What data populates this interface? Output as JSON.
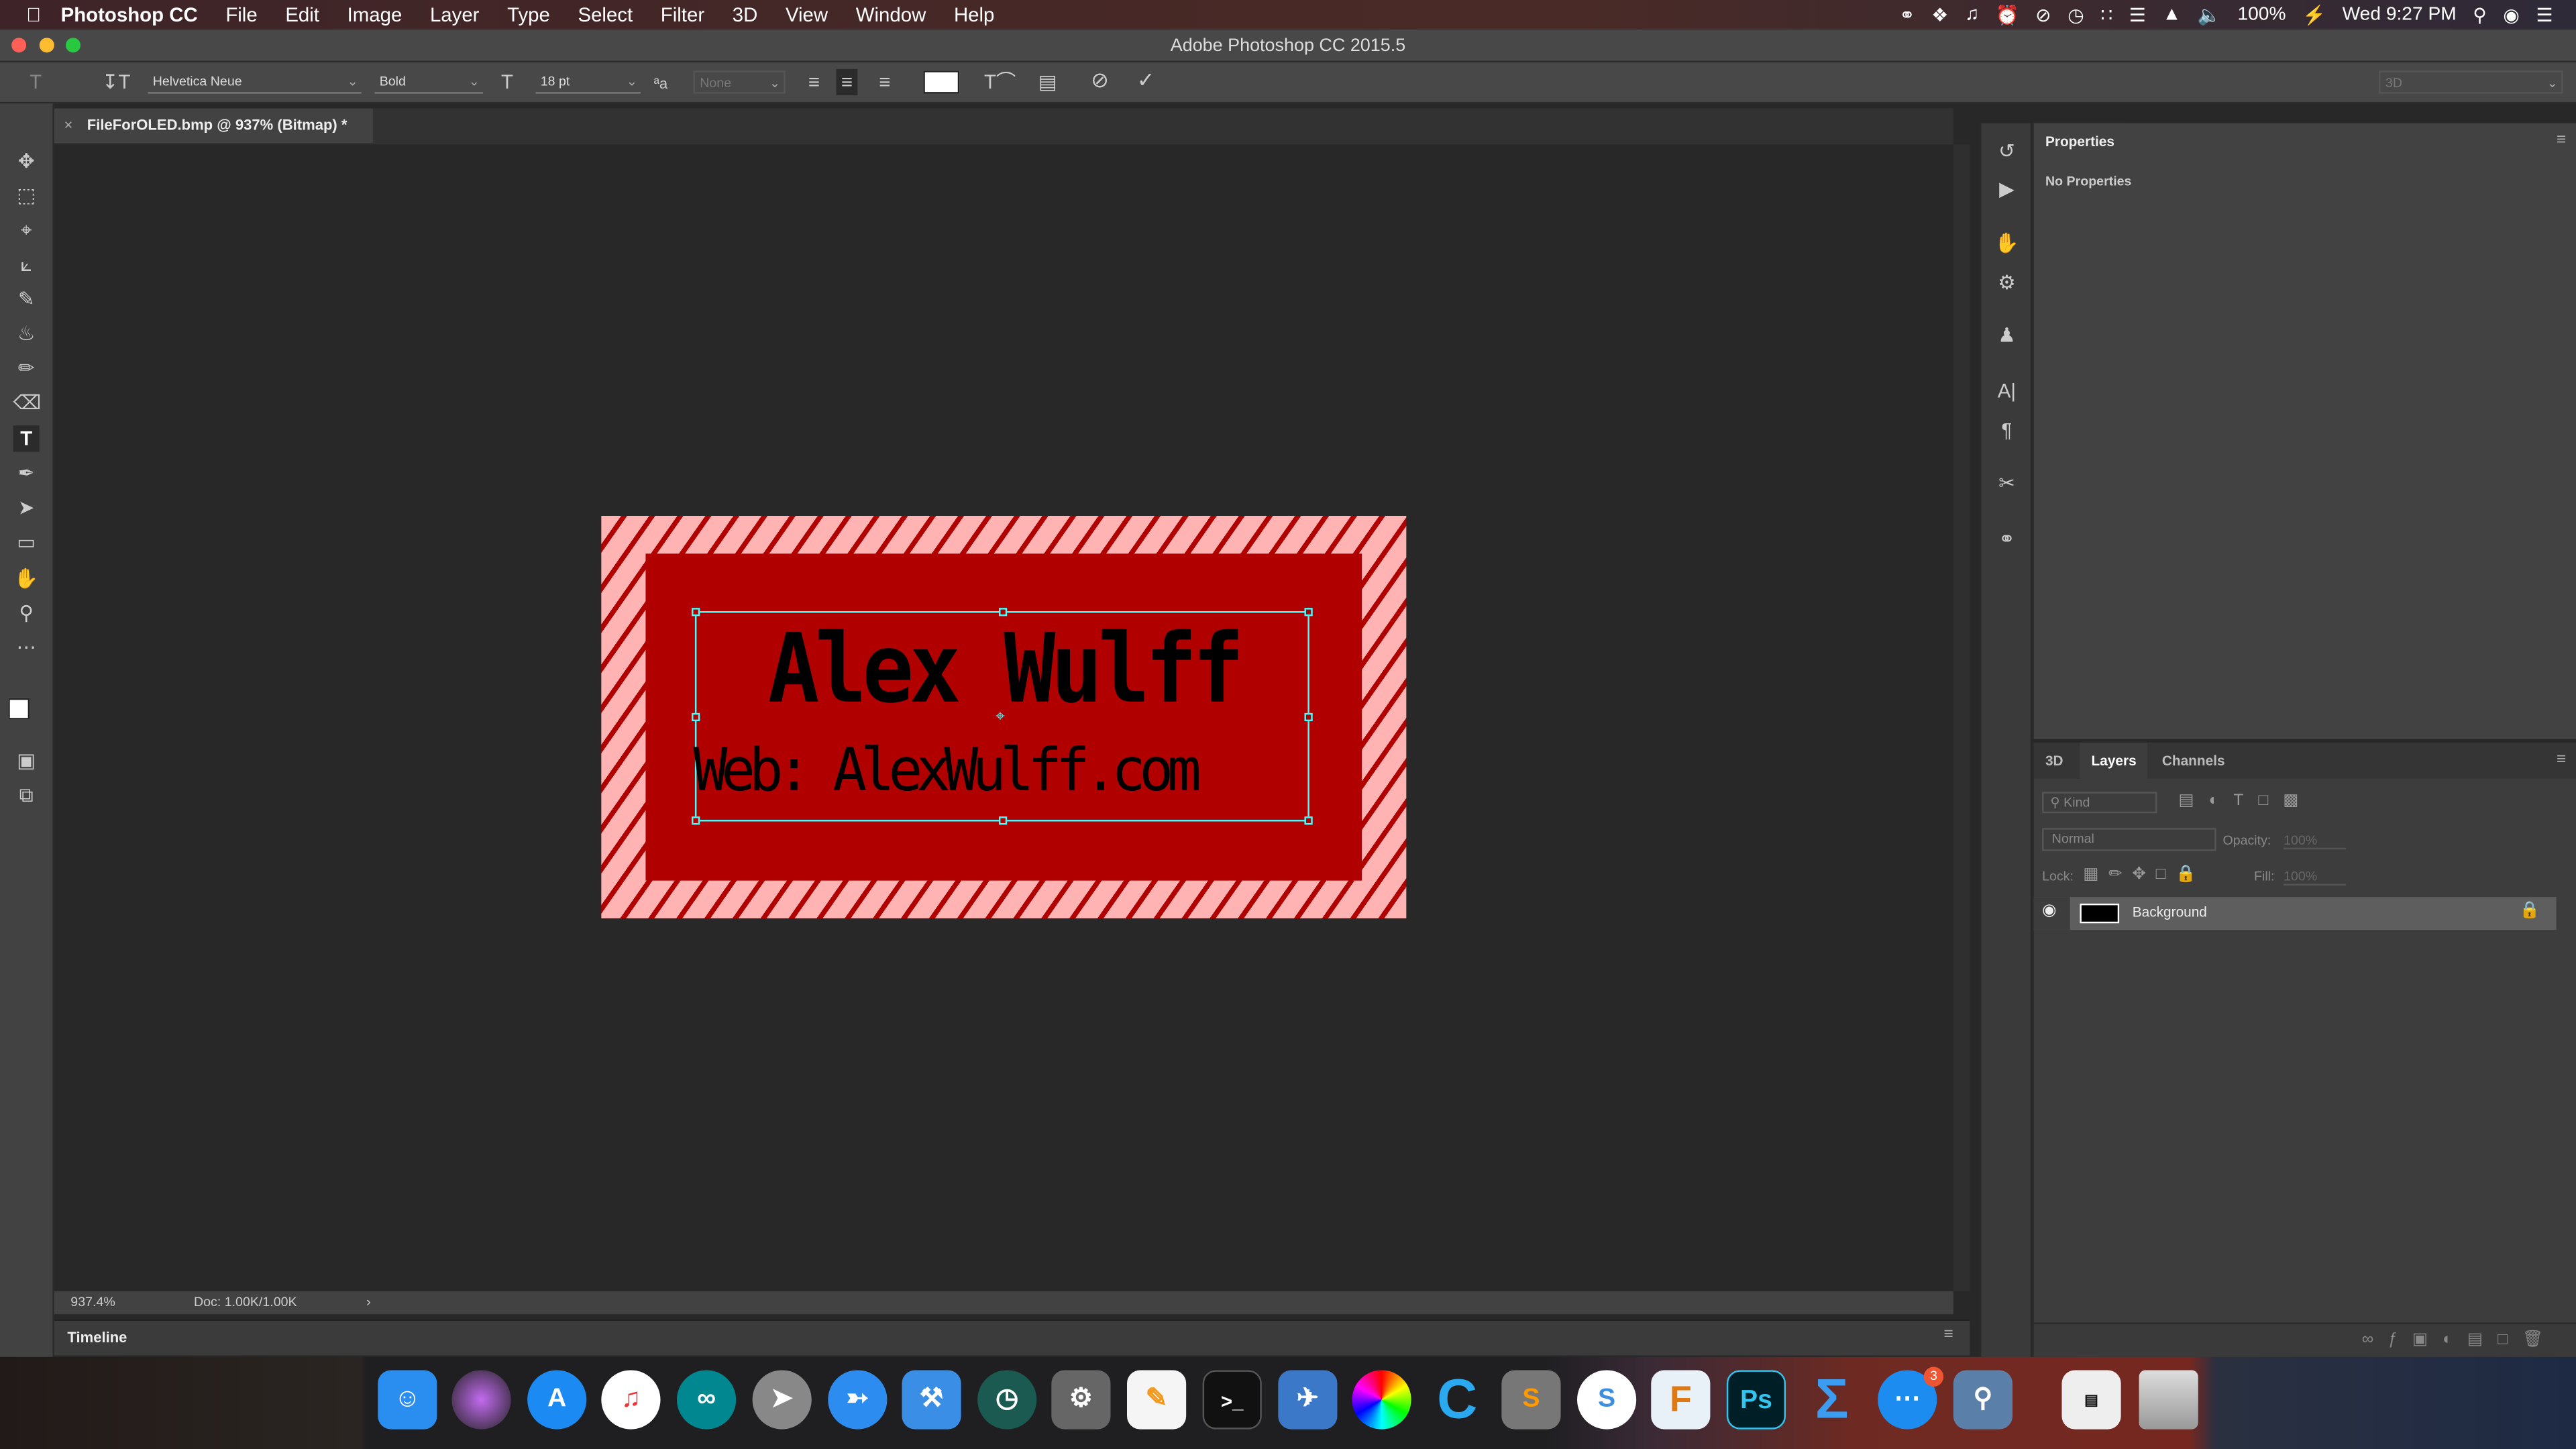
{
  "menubar": {
    "app": "Photoshop CC",
    "items": [
      "File",
      "Edit",
      "Image",
      "Layer",
      "Type",
      "Select",
      "Filter",
      "3D",
      "View",
      "Window",
      "Help"
    ],
    "battery": "100%",
    "clock": "Wed 9:27 PM"
  },
  "window": {
    "title": "Adobe Photoshop CC 2015.5"
  },
  "options": {
    "font_family": "Helvetica Neue",
    "font_style": "Bold",
    "font_size": "18 pt",
    "anti_alias": "None",
    "workspace": "3D",
    "text_color": "#ffffff"
  },
  "document": {
    "tab_label": "FileForOLED.bmp @ 937% (Bitmap) *",
    "zoom": "937.4%",
    "doc_size": "Doc: 1.00K/1.00K"
  },
  "artwork": {
    "line1": "Alex Wulff",
    "line2": "Web: AlexWulff.com",
    "colors": {
      "stripe_light": "#ffb3b3",
      "red": "#b00000",
      "text": "#000000"
    }
  },
  "timeline": {
    "label": "Timeline"
  },
  "properties": {
    "title": "Properties",
    "empty": "No Properties"
  },
  "layers": {
    "tabs": [
      "3D",
      "Layers",
      "Channels"
    ],
    "active_tab": "Layers",
    "filter": "Kind",
    "blend_mode": "Normal",
    "opacity_label": "Opacity:",
    "opacity": "100%",
    "lock_label": "Lock:",
    "fill_label": "Fill:",
    "fill": "100%",
    "items": [
      {
        "name": "Background",
        "visible": true,
        "locked": true
      }
    ]
  },
  "dock": {
    "badge": "3",
    "apps": [
      "Finder",
      "Siri",
      "App Store",
      "iTunes",
      "Arduino",
      "Launchpad",
      "Safari",
      "Xcode",
      "Time Machine",
      "System Preferences",
      "Pages",
      "Terminal",
      "Preview",
      "Color Picker",
      "C",
      "Sublime Text",
      "Simplenote",
      "Fusion 360",
      "Photoshop",
      "Sigma",
      "Messenger",
      "Image Capture",
      "Downloads",
      "Trash"
    ]
  }
}
